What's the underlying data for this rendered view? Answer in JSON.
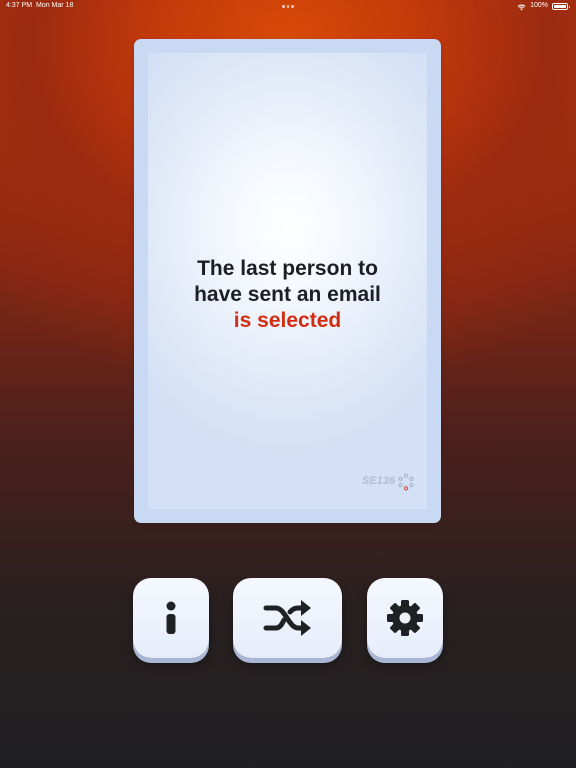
{
  "status_bar": {
    "time": "4:37 PM",
    "date": "Mon Mar 18",
    "battery": "100%"
  },
  "card": {
    "line1": "The last person to",
    "line2": "have sent an email",
    "highlight": "is selected",
    "code": "SE136",
    "highlight_color": "#d22d10",
    "logo_icon": "dotted-circle-logo-icon"
  },
  "buttons": {
    "info": {
      "icon": "info-icon"
    },
    "shuffle": {
      "icon": "shuffle-icon"
    },
    "settings": {
      "icon": "gear-icon"
    }
  }
}
